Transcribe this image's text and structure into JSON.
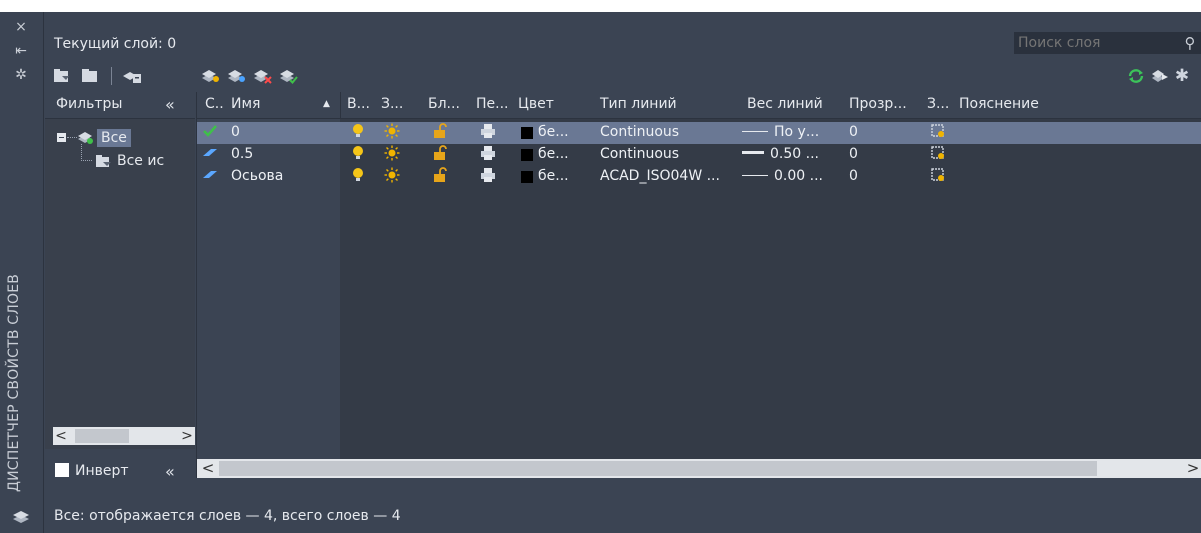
{
  "rail": {
    "close_glyph": "×",
    "autohide_glyph": "⇤",
    "props_glyph": "✲",
    "title": "ДИСПЕТЧЕР СВОЙСТВ СЛОЕВ",
    "bottom_icon": "layer-icon"
  },
  "header": {
    "current_layer": "Текущий слой: 0"
  },
  "search": {
    "placeholder": "Поиск слоя"
  },
  "toolbar": {
    "left": [
      "new-property-filter-icon",
      "new-group-filter-icon",
      "layer-states-icon"
    ],
    "middle": [
      "new-layer-icon",
      "new-layer-vp-frozen-icon",
      "delete-layer-icon",
      "set-current-icon"
    ],
    "right": [
      "refresh-icon",
      "settings-arrow-icon",
      "settings-gear-icon"
    ]
  },
  "filters": {
    "header": "Фильтры",
    "collapse_glyph": "«",
    "tree": [
      {
        "label": "Все",
        "expanded": true,
        "selected": true
      },
      {
        "label": "Все ис",
        "child": true
      }
    ],
    "scroll_left": "<",
    "scroll_right": ">",
    "invert_label": "Инверт",
    "invert_checked": false
  },
  "grid": {
    "columns": [
      "С..",
      "Имя",
      "В...",
      "З...",
      "Бл...",
      "Пе...",
      "Цвет",
      "Тип линий",
      "Вес линий",
      "Прозр...",
      "З...",
      "Пояснение"
    ],
    "sort_glyph": "▲",
    "rows": [
      {
        "status": "current",
        "name": "0",
        "color": "бе...",
        "linetype": "Continuous",
        "lineweight": "По у...",
        "transparency": "0",
        "selected": true
      },
      {
        "status": "layer",
        "name": "0.5",
        "color": "бе...",
        "linetype": "Continuous",
        "lineweight": "0.50 ...",
        "transparency": "0",
        "selected": false
      },
      {
        "status": "layer",
        "name": "Осьова",
        "color": "бе...",
        "linetype": "ACAD_ISO04W ...",
        "lineweight": "0.00 ...",
        "transparency": "0",
        "selected": false
      }
    ],
    "scroll_left": "<",
    "scroll_right": ">"
  },
  "status_bar": {
    "text": "Все: отображается слоев — 4, всего слоев — 4"
  },
  "colors": {
    "panel": "#3b4453",
    "selection": "#6a7894",
    "current_check": "#3fc04a",
    "bulb": "#f5c518",
    "sun": "#f0b400",
    "lock": "#e7a51a",
    "refresh": "#3cc35a",
    "status_layer": "#5ba7ff"
  }
}
